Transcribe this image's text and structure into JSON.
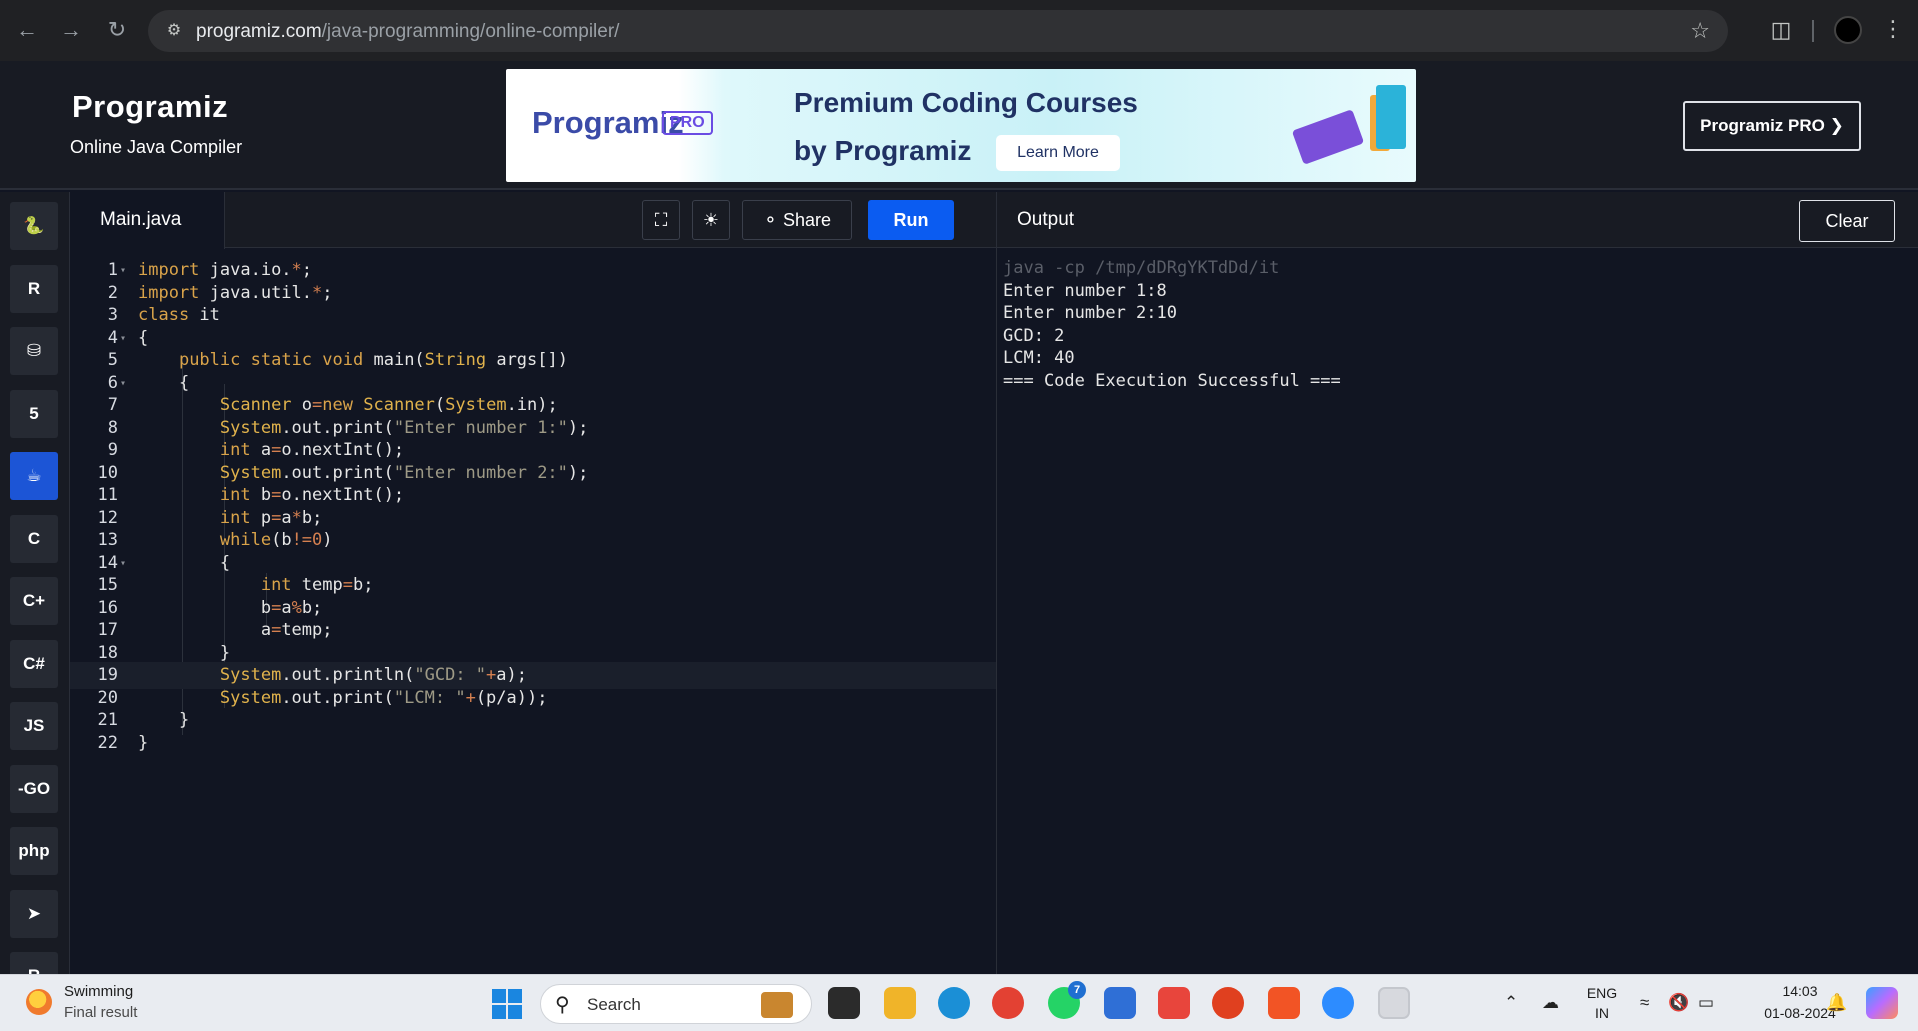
{
  "browser": {
    "url_host": "programiz.com",
    "url_path": "/java-programming/online-compiler/"
  },
  "header": {
    "logo": "Programiz",
    "subtitle": "Online Java Compiler",
    "banner": {
      "logo": "Programiz",
      "pro_tag": "PRO",
      "headline_line1": "Premium Coding Courses",
      "headline_line2": "by Programiz",
      "cta": "Learn More"
    },
    "pro_button": "Programiz PRO ❯"
  },
  "languages": [
    {
      "name": "python-icon",
      "glyph": "🐍"
    },
    {
      "name": "r-icon",
      "glyph": "R"
    },
    {
      "name": "sql-icon",
      "glyph": "⛁"
    },
    {
      "name": "html-icon",
      "glyph": "5"
    },
    {
      "name": "java-icon",
      "glyph": "☕",
      "active": true
    },
    {
      "name": "c-icon",
      "glyph": "C"
    },
    {
      "name": "cpp-icon",
      "glyph": "C+"
    },
    {
      "name": "csharp-icon",
      "glyph": "C#"
    },
    {
      "name": "javascript-icon",
      "glyph": "JS"
    },
    {
      "name": "go-icon",
      "glyph": "-GO"
    },
    {
      "name": "php-icon",
      "glyph": "php"
    },
    {
      "name": "swift-icon",
      "glyph": "➤"
    },
    {
      "name": "rust-icon",
      "glyph": "R"
    }
  ],
  "editor": {
    "filename": "Main.java",
    "share_label": "Share",
    "run_label": "Run",
    "lines": [
      {
        "n": "1",
        "fold": true,
        "text": "import java.io.*;"
      },
      {
        "n": "2",
        "fold": false,
        "text": "import java.util.*;"
      },
      {
        "n": "3",
        "fold": false,
        "text": "class it"
      },
      {
        "n": "4",
        "fold": true,
        "text": "{"
      },
      {
        "n": "5",
        "fold": false,
        "text": "    public static void main(String args[])"
      },
      {
        "n": "6",
        "fold": true,
        "text": "    {"
      },
      {
        "n": "7",
        "fold": false,
        "text": "        Scanner o=new Scanner(System.in);"
      },
      {
        "n": "8",
        "fold": false,
        "text": "        System.out.print(\"Enter number 1:\");"
      },
      {
        "n": "9",
        "fold": false,
        "text": "        int a=o.nextInt();"
      },
      {
        "n": "10",
        "fold": false,
        "text": "        System.out.print(\"Enter number 2:\");"
      },
      {
        "n": "11",
        "fold": false,
        "text": "        int b=o.nextInt();"
      },
      {
        "n": "12",
        "fold": false,
        "text": "        int p=a*b;"
      },
      {
        "n": "13",
        "fold": false,
        "text": "        while(b!=0)"
      },
      {
        "n": "14",
        "fold": true,
        "text": "        {"
      },
      {
        "n": "15",
        "fold": false,
        "text": "            int temp=b;"
      },
      {
        "n": "16",
        "fold": false,
        "text": "            b=a%b;"
      },
      {
        "n": "17",
        "fold": false,
        "text": "            a=temp;"
      },
      {
        "n": "18",
        "fold": false,
        "text": "        }"
      },
      {
        "n": "19",
        "fold": false,
        "text": "        System.out.println(\"GCD: \"+a);",
        "highlight": true
      },
      {
        "n": "20",
        "fold": false,
        "text": "        System.out.print(\"LCM: \"+(p/a));"
      },
      {
        "n": "21",
        "fold": false,
        "text": "    }"
      },
      {
        "n": "22",
        "fold": false,
        "text": "}"
      }
    ]
  },
  "output": {
    "title": "Output",
    "clear_label": "Clear",
    "lines": [
      {
        "text": "java -cp /tmp/dDRgYKTdDd/it",
        "cmd": true
      },
      {
        "text": "Enter number 1:8",
        "cmd": false
      },
      {
        "text": "Enter number 2:10",
        "cmd": false
      },
      {
        "text": "GCD: 2",
        "cmd": false
      },
      {
        "text": "LCM: 40",
        "cmd": false
      },
      {
        "text": "=== Code Execution Successful ===",
        "cmd": false
      }
    ]
  },
  "taskbar": {
    "weather_title": "Swimming",
    "weather_sub": "Final result",
    "search_placeholder": "Search",
    "whatsapp_badge": "7",
    "lang_line1": "ENG",
    "lang_line2": "IN",
    "time": "14:03",
    "date": "01-08-2024"
  },
  "colors": {
    "accent": "#0b5cf1",
    "background": "#111522",
    "panel": "#181b23",
    "keyword": "#d9a34a",
    "string": "#9e9a86"
  }
}
